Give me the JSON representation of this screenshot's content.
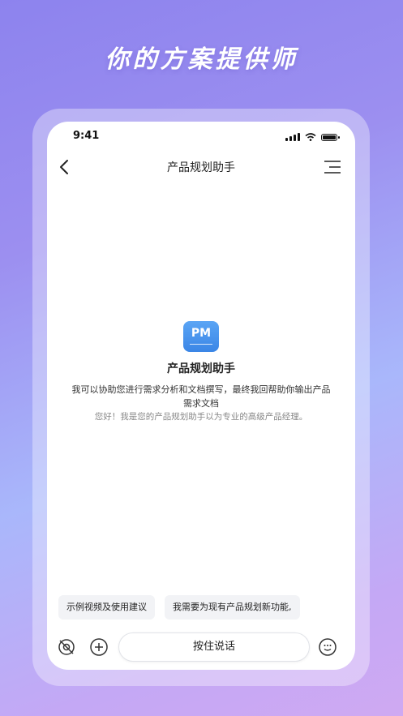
{
  "headline": "你的方案提供师",
  "status_bar": {
    "time": "9:41"
  },
  "nav": {
    "title": "产品规划助手",
    "back_icon": "chevron-left-icon",
    "menu_icon": "menu-lines-icon"
  },
  "assistant": {
    "logo_text": "PM",
    "name": "产品规划助手",
    "intro": "我可以协助您进行需求分析和文档撰写，最终我回帮助你输出产品需求文档",
    "greeting": "您好！我是您的产品规划助手以为专业的高级产品经理。"
  },
  "suggestions": [
    "示例视频及使用建议",
    "我需要为现有产品规划新功能,"
  ],
  "input_bar": {
    "voice_label": "按住说话",
    "left_icons": [
      "mute-camera-icon",
      "plus-circle-icon"
    ],
    "right_icon": "emoji-icon"
  },
  "colors": {
    "accent": "#3b86e6",
    "background_start": "#8d83ee",
    "background_end": "#cfa9f2"
  }
}
